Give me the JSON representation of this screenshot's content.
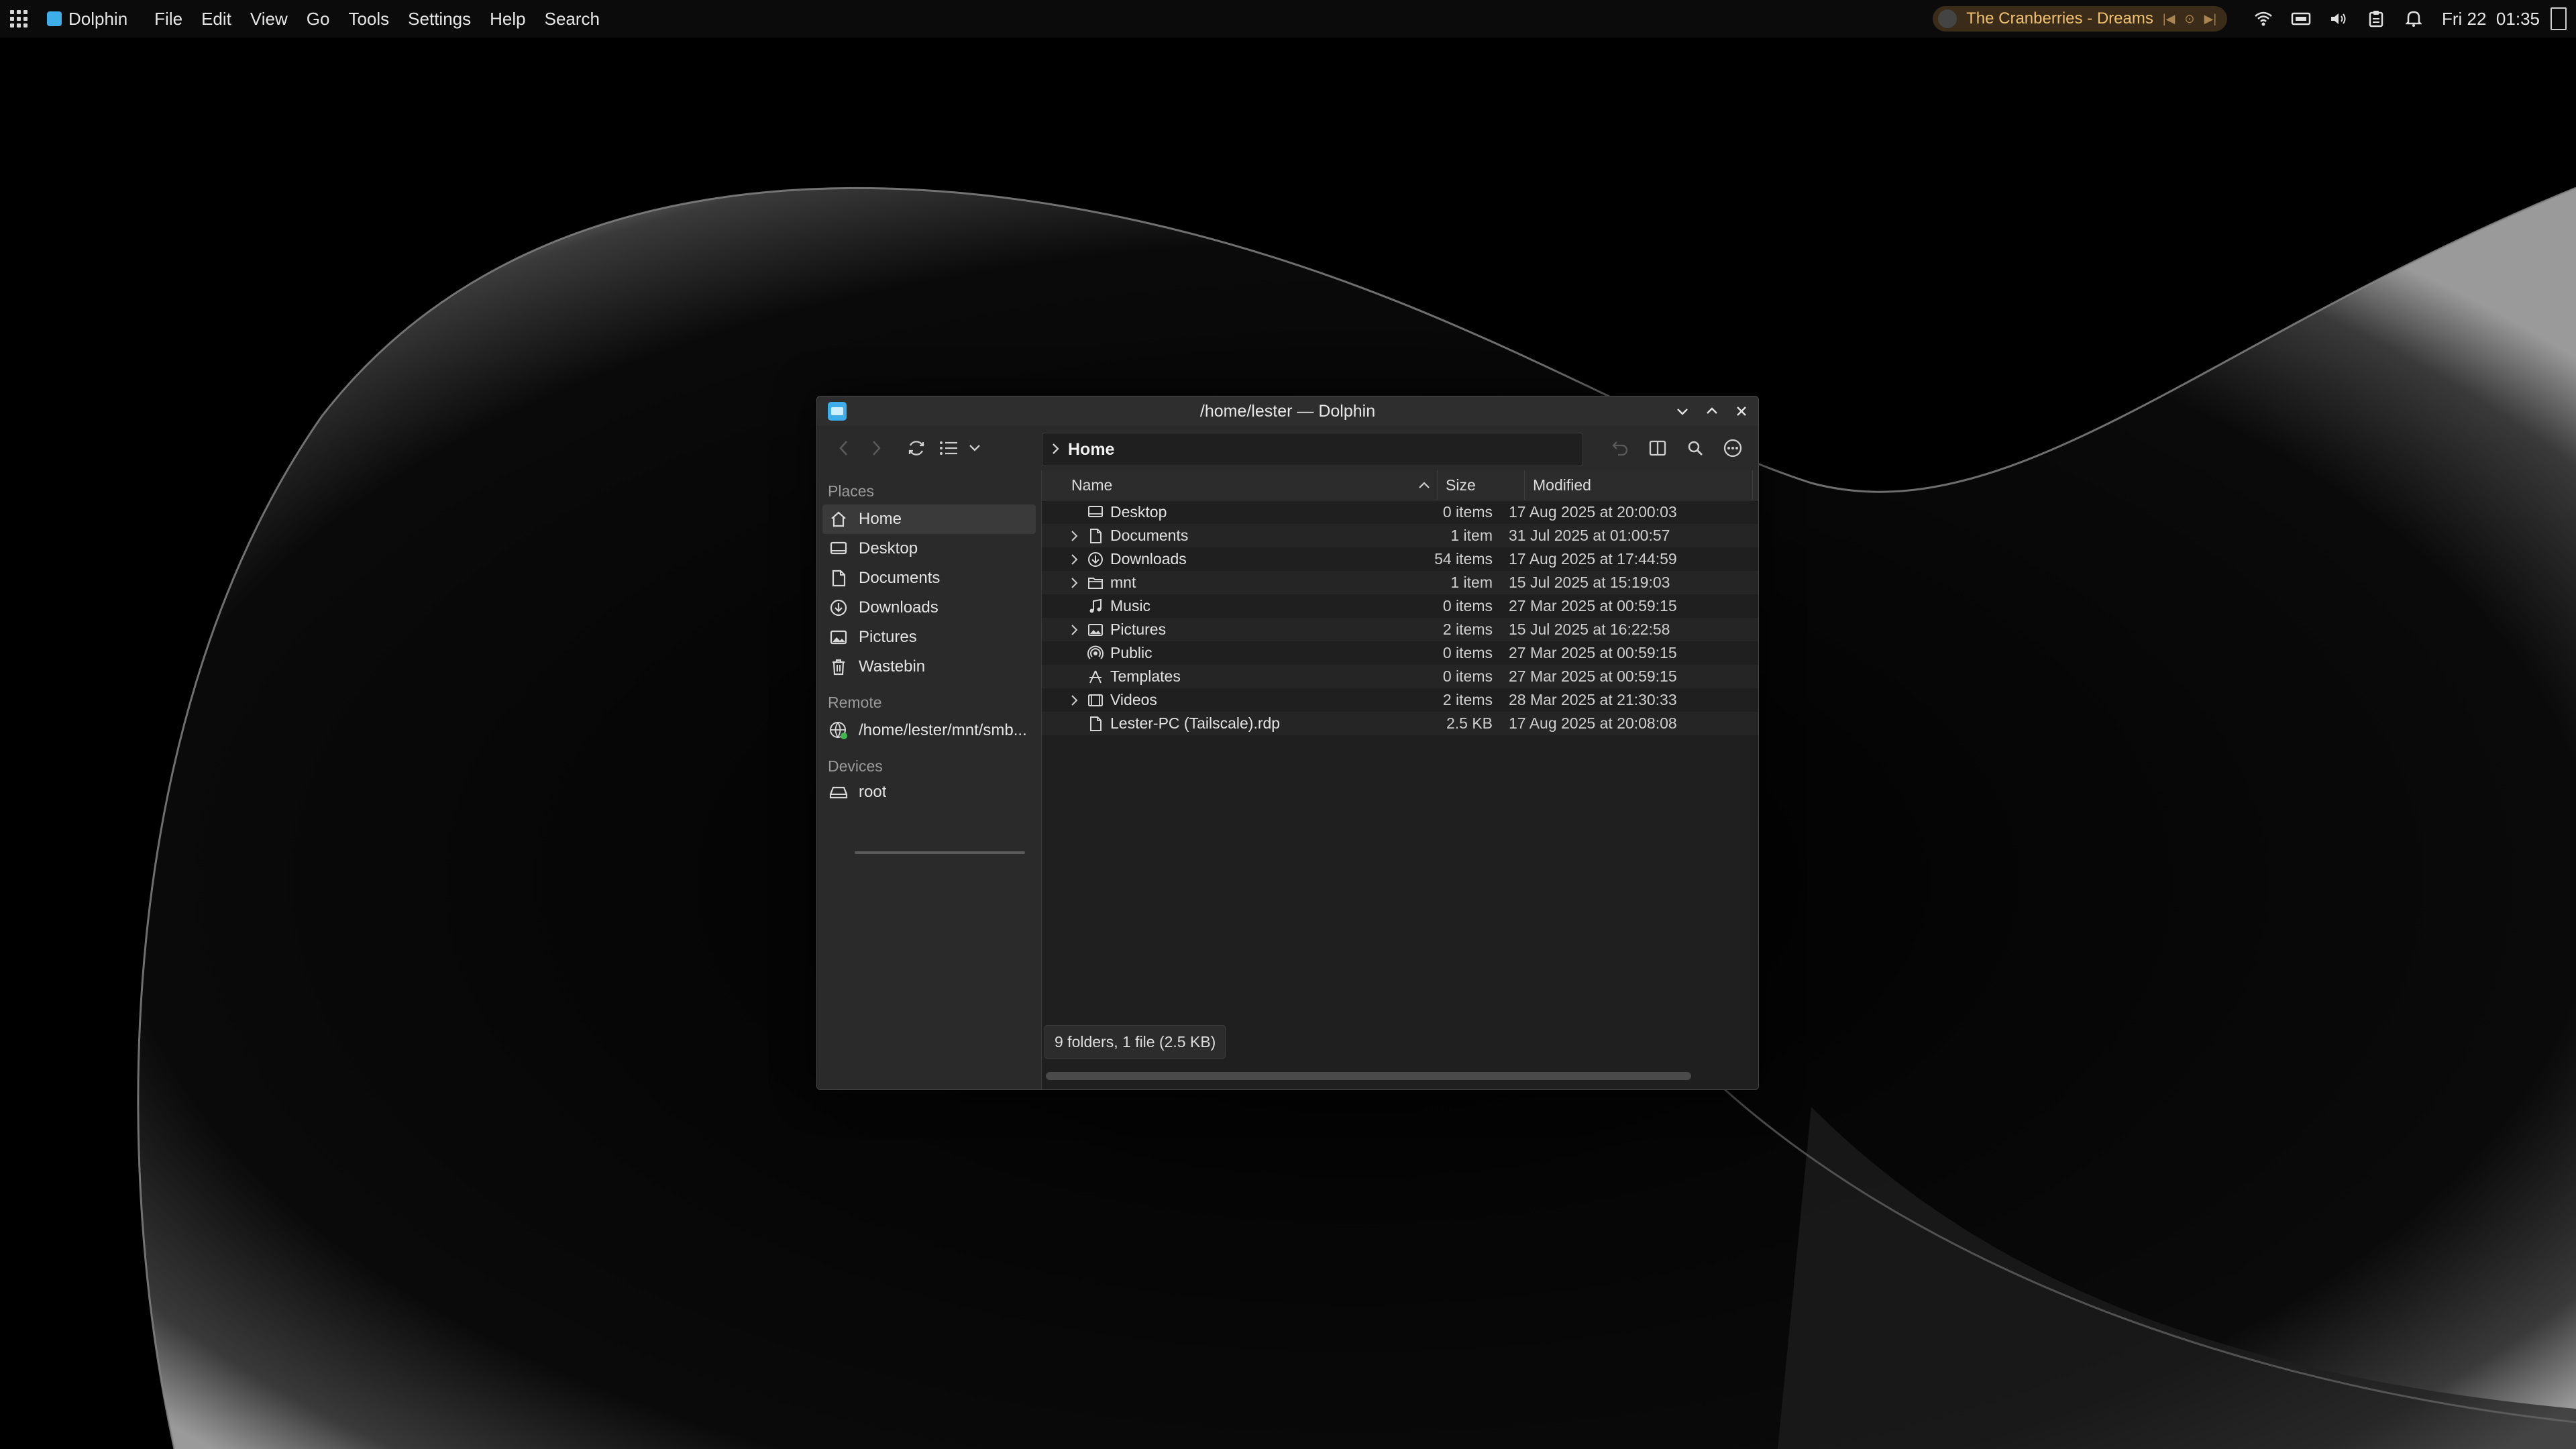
{
  "topbar": {
    "app_name": "Dolphin",
    "menu": [
      "File",
      "Edit",
      "View",
      "Go",
      "Tools",
      "Settings",
      "Help",
      "Search"
    ],
    "media_title": "The Cranberries - Dreams",
    "clock": "Fri 22  01:35",
    "icons": [
      "app-launcher-icon",
      "wifi-icon",
      "network-icon",
      "volume-icon",
      "clipboard-icon",
      "bell-icon"
    ]
  },
  "window": {
    "title": "/home/lester — Dolphin",
    "breadcrumb": "Home",
    "status": "9 folders, 1 file (2.5 KB)"
  },
  "places": {
    "sections": {
      "places": "Places",
      "remote": "Remote",
      "devices": "Devices"
    },
    "items": [
      {
        "label": "Home",
        "icon": "home-icon"
      },
      {
        "label": "Desktop",
        "icon": "desktop-icon"
      },
      {
        "label": "Documents",
        "icon": "document-icon"
      },
      {
        "label": "Downloads",
        "icon": "download-icon"
      },
      {
        "label": "Pictures",
        "icon": "picture-icon"
      },
      {
        "label": "Wastebin",
        "icon": "trash-icon"
      }
    ],
    "remote": [
      {
        "label": "/home/lester/mnt/smb..."
      }
    ],
    "devices": [
      {
        "label": "root",
        "usage_fraction": 1.0
      }
    ]
  },
  "columns": {
    "name": "Name",
    "size": "Size",
    "modified": "Modified"
  },
  "files": [
    {
      "name": "Desktop",
      "size": "0 items",
      "modified": "17 Aug 2025 at 20:00:03",
      "expandable": false,
      "icon": "desktop-icon"
    },
    {
      "name": "Documents",
      "size": "1 item",
      "modified": "31 Jul 2025 at 01:00:57",
      "expandable": true,
      "icon": "document-icon"
    },
    {
      "name": "Downloads",
      "size": "54 items",
      "modified": "17 Aug 2025 at 17:44:59",
      "expandable": true,
      "icon": "download-icon"
    },
    {
      "name": "mnt",
      "size": "1 item",
      "modified": "15 Jul 2025 at 15:19:03",
      "expandable": true,
      "icon": "folder-icon"
    },
    {
      "name": "Music",
      "size": "0 items",
      "modified": "27 Mar 2025 at 00:59:15",
      "expandable": false,
      "icon": "music-icon"
    },
    {
      "name": "Pictures",
      "size": "2 items",
      "modified": "15 Jul 2025 at 16:22:58",
      "expandable": true,
      "icon": "picture-icon"
    },
    {
      "name": "Public",
      "size": "0 items",
      "modified": "27 Mar 2025 at 00:59:15",
      "expandable": false,
      "icon": "share-icon"
    },
    {
      "name": "Templates",
      "size": "0 items",
      "modified": "27 Mar 2025 at 00:59:15",
      "expandable": false,
      "icon": "template-icon"
    },
    {
      "name": "Videos",
      "size": "2 items",
      "modified": "28 Mar 2025 at 21:30:33",
      "expandable": true,
      "icon": "video-icon"
    },
    {
      "name": "Lester-PC (Tailscale).rdp",
      "size": "2.5 KB",
      "modified": "17 Aug 2025 at 20:08:08",
      "expandable": false,
      "icon": "file-icon"
    }
  ]
}
